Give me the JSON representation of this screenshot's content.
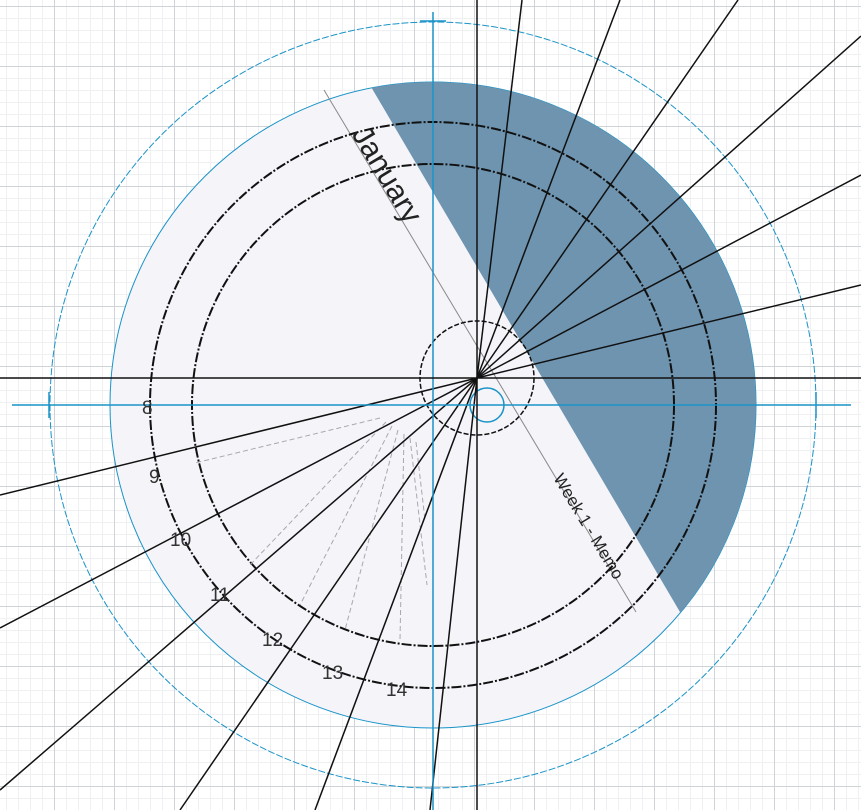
{
  "dial": {
    "month_label": "January",
    "memo_label": "Week 1 - Memo",
    "hour_labels": [
      "8",
      "9",
      "10",
      "11",
      "12",
      "13",
      "14"
    ]
  },
  "colors": {
    "face": "#f4f4f9",
    "shaded_sector": "#6e94b0",
    "guide_blue": "#1a93c8",
    "ink": "#111111",
    "dashed": "#a8a8b0"
  }
}
